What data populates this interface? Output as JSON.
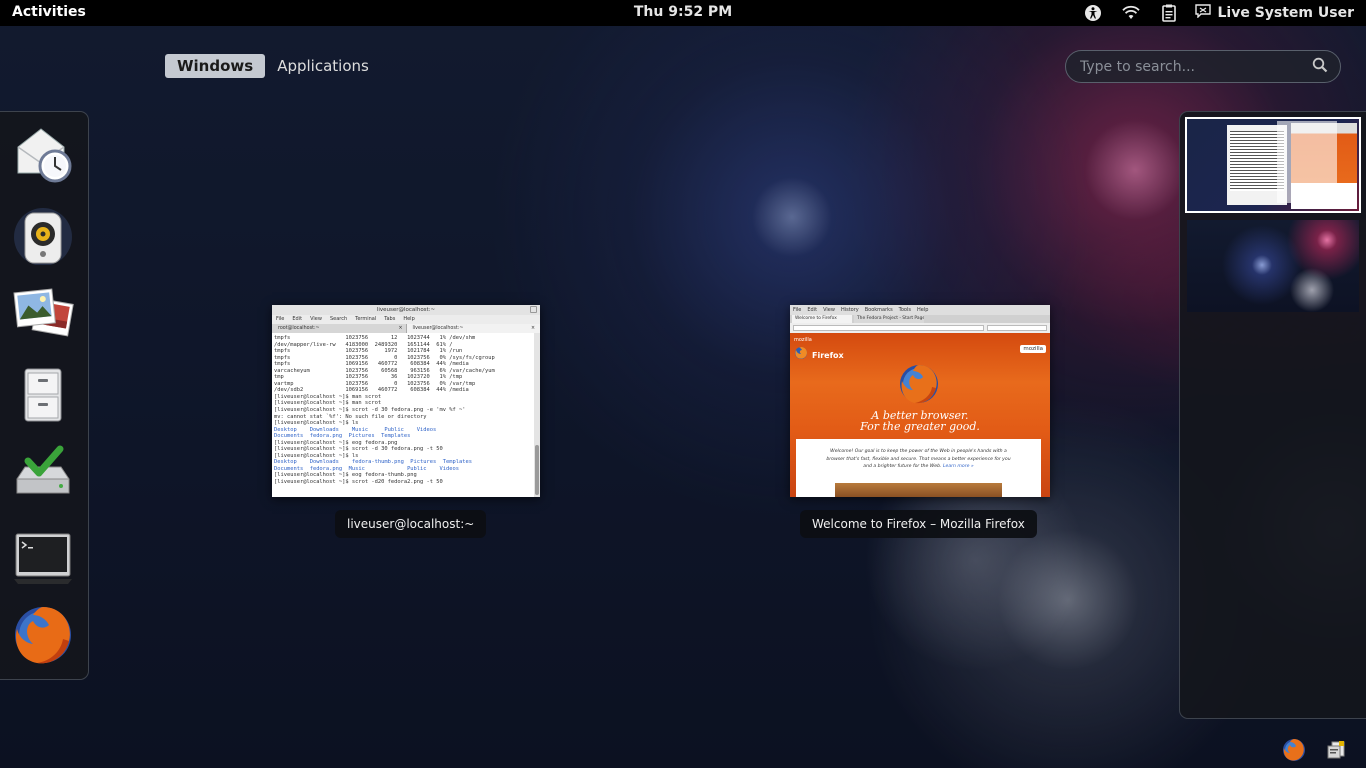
{
  "topbar": {
    "activities_label": "Activities",
    "clock": "Thu  9:52 PM",
    "user_name": "Live System User",
    "icons": [
      "accessibility-icon",
      "wifi-icon",
      "clipboard-icon",
      "chat-status-icon"
    ]
  },
  "overview": {
    "tabs": [
      {
        "label": "Windows",
        "active": true
      },
      {
        "label": "Applications",
        "active": false
      }
    ],
    "search": {
      "placeholder": "Type to search..."
    }
  },
  "dash": {
    "items": [
      {
        "name": "evolution-mail-calendar-icon"
      },
      {
        "name": "rhythmbox-music-icon"
      },
      {
        "name": "shotwell-photos-icon"
      },
      {
        "name": "file-manager-cabinet-icon"
      },
      {
        "name": "install-to-hard-drive-icon"
      },
      {
        "name": "terminal-icon"
      },
      {
        "name": "firefox-icon"
      }
    ]
  },
  "windows": [
    {
      "caption": "liveuser@localhost:~",
      "title": "liveuser@localhost:~",
      "menu": [
        "File",
        "Edit",
        "View",
        "Search",
        "Terminal",
        "Tabs",
        "Help"
      ],
      "tabs": [
        "root@localhost:~",
        "liveuser@localhost:~"
      ],
      "lines": [
        {
          "t": "tmpfs                 1023756       12   1023744   1% /dev/shm",
          "c": ""
        },
        {
          "t": "/dev/mapper/live-rw   4183000  2489320   1651144  61% /",
          "c": ""
        },
        {
          "t": "tmpfs                 1023756     1972   1021784   1% /run",
          "c": ""
        },
        {
          "t": "tmpfs                 1023756        0   1023756   0% /sys/fs/cgroup",
          "c": ""
        },
        {
          "t": "tmpfs                 1069156   460772    608384  44% /media",
          "c": ""
        },
        {
          "t": "varcacheyum           1023756    60568    963156   6% /var/cache/yum",
          "c": ""
        },
        {
          "t": "tmp                   1023756       36   1023720   1% /tmp",
          "c": ""
        },
        {
          "t": "vartmp                1023756        0   1023756   0% /var/tmp",
          "c": ""
        },
        {
          "t": "/dev/sdb2             1069156   460772    608384  44% /media",
          "c": ""
        },
        {
          "t": "[liveuser@localhost ~]$ man scrot",
          "c": ""
        },
        {
          "t": "[liveuser@localhost ~]$ man scrot",
          "c": ""
        },
        {
          "t": "[liveuser@localhost ~]$ scrot -d 30 fedora.png -e 'mv %f ~'",
          "c": ""
        },
        {
          "t": "mv: cannot stat `%f': No such file or directory",
          "c": ""
        },
        {
          "t": "[liveuser@localhost ~]$ ls",
          "c": ""
        },
        {
          "t": "Desktop    Downloads    Music     Public    Videos",
          "c": "blue"
        },
        {
          "t": "Documents  fedora.png  Pictures  Templates",
          "c": "blue"
        },
        {
          "t": "[liveuser@localhost ~]$ eog fedora.png",
          "c": ""
        },
        {
          "t": "[liveuser@localhost ~]$ scrot -d 30 fedora.png -t 50",
          "c": ""
        },
        {
          "t": "[liveuser@localhost ~]$ ls",
          "c": ""
        },
        {
          "t": "Desktop    Downloads    fedora-thumb.png  Pictures  Templates",
          "c": "blue"
        },
        {
          "t": "Documents  fedora.png  Music             Public    Videos",
          "c": "blue"
        },
        {
          "t": "[liveuser@localhost ~]$ eog fedora-thumb.png",
          "c": ""
        },
        {
          "t": "[liveuser@localhost ~]$ scrot -d20 fedora2.png -t 50",
          "c": ""
        }
      ]
    },
    {
      "caption": "Welcome to Firefox – Mozilla Firefox",
      "menu": [
        "File",
        "Edit",
        "View",
        "History",
        "Bookmarks",
        "Tools",
        "Help"
      ],
      "tabs": [
        "Welcome to Firefox",
        "The Fedora Project - Start Page"
      ],
      "brand_small": "mozilla",
      "brand_big": "Firefox",
      "mozilla_badge": "mozilla",
      "headline": "A better browser.",
      "subheadline": "For the greater good.",
      "body": "Welcome! Our goal is to keep the power of the Web in people's hands with a browser that's fast, flexible and secure. That means a better experience for you and a brighter future for the Web.",
      "learn_more": "Learn more »"
    }
  ],
  "tray": {
    "icons": [
      "firefox-tray-icon",
      "notification-tray-icon"
    ]
  },
  "colors": {
    "topbar": "#000000",
    "firefox_orange": "#e25b16",
    "tab_active": "#c4c9d1"
  }
}
